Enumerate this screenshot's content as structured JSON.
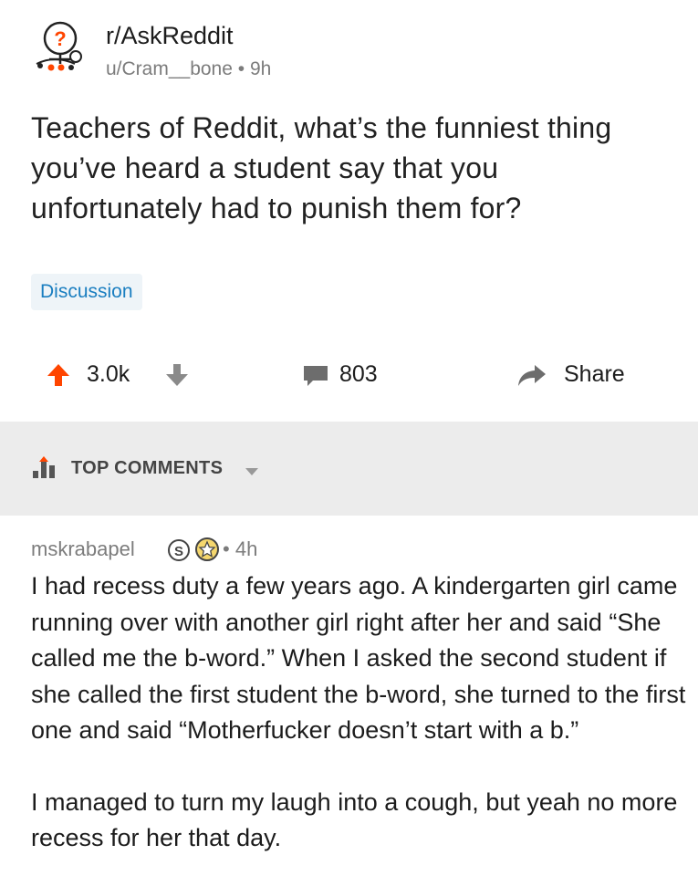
{
  "post": {
    "subreddit": "r/AskReddit",
    "author": "u/Cram__bone",
    "age": "9h",
    "title": "Teachers of Reddit, what’s the funniest thing you’ve heard a student say that you unfortunately had to punish them for?",
    "flair": "Discussion",
    "score": "3.0k",
    "comments": "803",
    "share_label": "Share",
    "avatar_icon": "askreddit-snoo-icon",
    "colors": {
      "upvote": "#ff4500",
      "flair_text": "#1a7ec0",
      "flair_bg": "#eef4f8",
      "muted": "#7c7c7c"
    }
  },
  "sort": {
    "label": "TOP COMMENTS",
    "icon": "sort-bars-icon"
  },
  "comment": {
    "username": "mskrabapel",
    "age": "4h",
    "paragraphs": [
      "I had recess duty a few years ago.  A kindergarten girl came running over with another girl right after her and said “She called me the b-word.”  When I asked the second student if she called the first student the b-word, she turned to the first one and said “Motherfucker doesn’t start with a b.”",
      "I managed to turn my laugh into a cough, but yeah no more recess for her that day."
    ]
  }
}
